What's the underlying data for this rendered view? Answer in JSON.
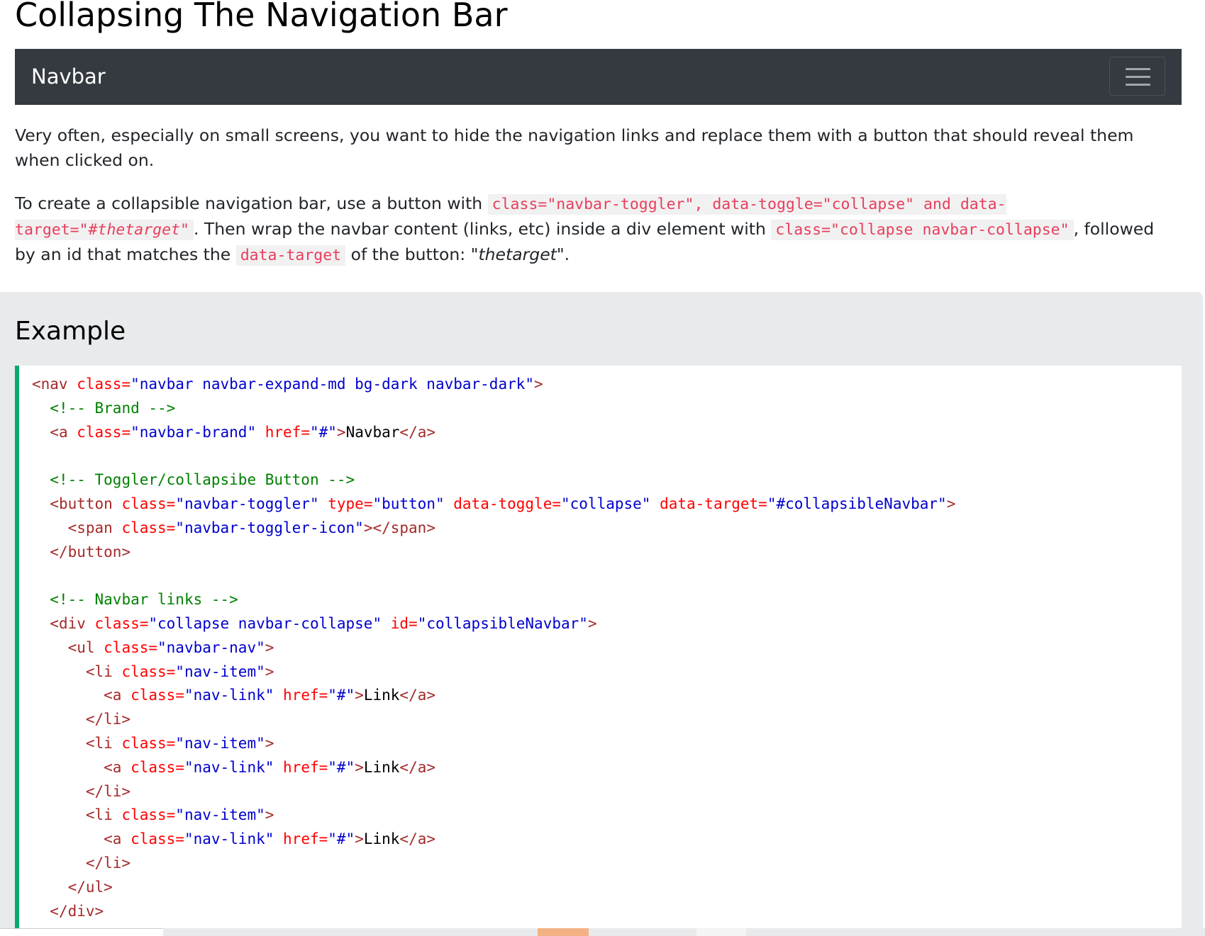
{
  "page": {
    "title": "Collapsing The Navigation Bar"
  },
  "navbar": {
    "brand": "Navbar",
    "toggler_icon": "hamburger-icon"
  },
  "paragraphs": {
    "p1": "Very often, especially on small screens, you want to hide the navigation links and replace them with a button that should reveal them when clicked on.",
    "p2": {
      "t1": "To create a collapsible navigation bar, use a button with ",
      "c1": "class=\"navbar-toggler\", data-toggle=\"collapse\" and data-target=\"#",
      "c1_em": "thetarget",
      "c1_end": "\"",
      "t2": ". Then wrap the navbar content (links, etc) inside a div element with ",
      "c2": "class=\"collapse navbar-collapse\"",
      "t3": ", followed by an id that matches the ",
      "c3": "data-target",
      "t4": " of the button: \"",
      "em": "thetarget",
      "t5": "\"."
    }
  },
  "example": {
    "heading": "Example",
    "code": [
      [
        [
          "tag",
          "<nav "
        ],
        [
          "attr",
          "class="
        ],
        [
          "val",
          "\"navbar navbar-expand-md bg-dark navbar-dark\""
        ],
        [
          "tag",
          ">"
        ]
      ],
      [
        [
          "text",
          "  "
        ],
        [
          "comment",
          "<!-- Brand -->"
        ]
      ],
      [
        [
          "text",
          "  "
        ],
        [
          "tag",
          "<a "
        ],
        [
          "attr",
          "class="
        ],
        [
          "val",
          "\"navbar-brand\""
        ],
        [
          "attr",
          " href="
        ],
        [
          "val",
          "\"#\""
        ],
        [
          "tag",
          ">"
        ],
        [
          "text",
          "Navbar"
        ],
        [
          "tag",
          "</a>"
        ]
      ],
      [],
      [
        [
          "text",
          "  "
        ],
        [
          "comment",
          "<!-- Toggler/collapsibe Button -->"
        ]
      ],
      [
        [
          "text",
          "  "
        ],
        [
          "tag",
          "<button "
        ],
        [
          "attr",
          "class="
        ],
        [
          "val",
          "\"navbar-toggler\""
        ],
        [
          "attr",
          " type="
        ],
        [
          "val",
          "\"button\""
        ],
        [
          "attr",
          " data-toggle="
        ],
        [
          "val",
          "\"collapse\""
        ],
        [
          "attr",
          " data-target="
        ],
        [
          "val",
          "\"#collapsibleNavbar\""
        ],
        [
          "tag",
          ">"
        ]
      ],
      [
        [
          "text",
          "    "
        ],
        [
          "tag",
          "<span "
        ],
        [
          "attr",
          "class="
        ],
        [
          "val",
          "\"navbar-toggler-icon\""
        ],
        [
          "tag",
          "></span>"
        ]
      ],
      [
        [
          "text",
          "  "
        ],
        [
          "tag",
          "</button>"
        ]
      ],
      [],
      [
        [
          "text",
          "  "
        ],
        [
          "comment",
          "<!-- Navbar links -->"
        ]
      ],
      [
        [
          "text",
          "  "
        ],
        [
          "tag",
          "<div "
        ],
        [
          "attr",
          "class="
        ],
        [
          "val",
          "\"collapse navbar-collapse\""
        ],
        [
          "attr",
          " id="
        ],
        [
          "val",
          "\"collapsibleNavbar\""
        ],
        [
          "tag",
          ">"
        ]
      ],
      [
        [
          "text",
          "    "
        ],
        [
          "tag",
          "<ul "
        ],
        [
          "attr",
          "class="
        ],
        [
          "val",
          "\"navbar-nav\""
        ],
        [
          "tag",
          ">"
        ]
      ],
      [
        [
          "text",
          "      "
        ],
        [
          "tag",
          "<li "
        ],
        [
          "attr",
          "class="
        ],
        [
          "val",
          "\"nav-item\""
        ],
        [
          "tag",
          ">"
        ]
      ],
      [
        [
          "text",
          "        "
        ],
        [
          "tag",
          "<a "
        ],
        [
          "attr",
          "class="
        ],
        [
          "val",
          "\"nav-link\""
        ],
        [
          "attr",
          " href="
        ],
        [
          "val",
          "\"#\""
        ],
        [
          "tag",
          ">"
        ],
        [
          "text",
          "Link"
        ],
        [
          "tag",
          "</a>"
        ]
      ],
      [
        [
          "text",
          "      "
        ],
        [
          "tag",
          "</li>"
        ]
      ],
      [
        [
          "text",
          "      "
        ],
        [
          "tag",
          "<li "
        ],
        [
          "attr",
          "class="
        ],
        [
          "val",
          "\"nav-item\""
        ],
        [
          "tag",
          ">"
        ]
      ],
      [
        [
          "text",
          "        "
        ],
        [
          "tag",
          "<a "
        ],
        [
          "attr",
          "class="
        ],
        [
          "val",
          "\"nav-link\""
        ],
        [
          "attr",
          " href="
        ],
        [
          "val",
          "\"#\""
        ],
        [
          "tag",
          ">"
        ],
        [
          "text",
          "Link"
        ],
        [
          "tag",
          "</a>"
        ]
      ],
      [
        [
          "text",
          "      "
        ],
        [
          "tag",
          "</li>"
        ]
      ],
      [
        [
          "text",
          "      "
        ],
        [
          "tag",
          "<li "
        ],
        [
          "attr",
          "class="
        ],
        [
          "val",
          "\"nav-item\""
        ],
        [
          "tag",
          ">"
        ]
      ],
      [
        [
          "text",
          "        "
        ],
        [
          "tag",
          "<a "
        ],
        [
          "attr",
          "class="
        ],
        [
          "val",
          "\"nav-link\""
        ],
        [
          "attr",
          " href="
        ],
        [
          "val",
          "\"#\""
        ],
        [
          "tag",
          ">"
        ],
        [
          "text",
          "Link"
        ],
        [
          "tag",
          "</a>"
        ]
      ],
      [
        [
          "text",
          "      "
        ],
        [
          "tag",
          "</li>"
        ]
      ],
      [
        [
          "text",
          "    "
        ],
        [
          "tag",
          "</ul>"
        ]
      ],
      [
        [
          "text",
          "  "
        ],
        [
          "tag",
          "</div>"
        ]
      ]
    ]
  },
  "colors": {
    "navbar_bg": "#343a40",
    "accent_border": "#04aa6d",
    "inline_code": "#e83e5c",
    "tag": "#a52a2a",
    "attr": "#ff0000",
    "value": "#0000cd",
    "comment": "#008000"
  }
}
